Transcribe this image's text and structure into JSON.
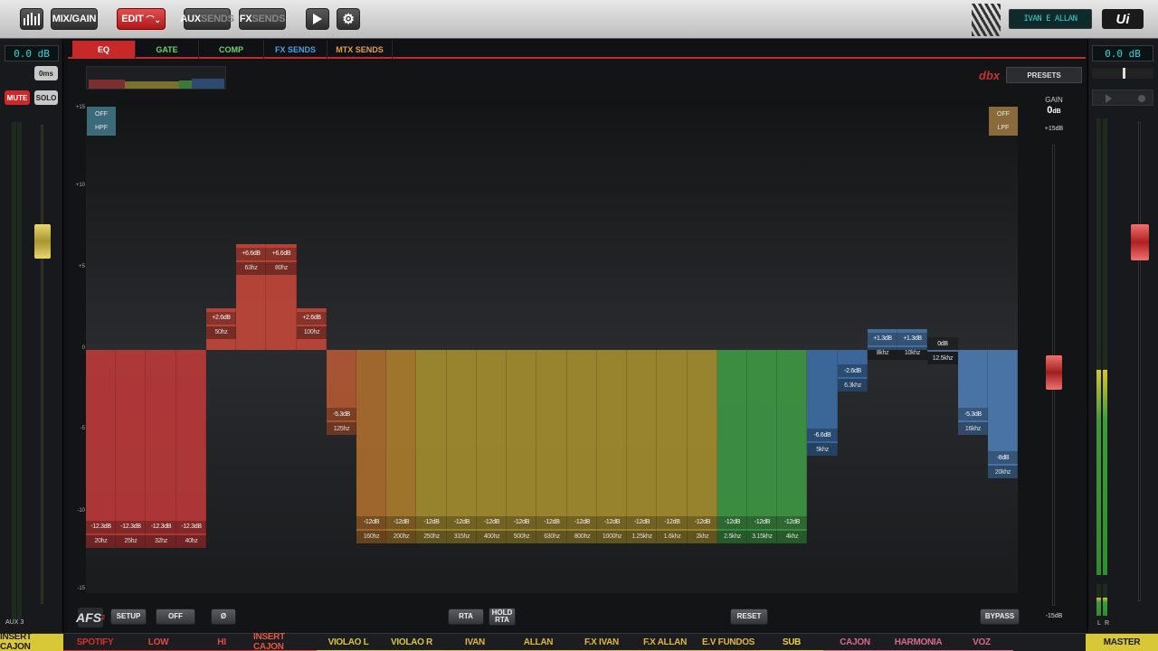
{
  "topbar": {
    "buttons": [
      {
        "id": "meters",
        "label": ""
      },
      {
        "id": "mixgain",
        "label": "MIX/GAIN"
      },
      {
        "id": "edit",
        "label": "EDIT"
      },
      {
        "id": "aux",
        "label_a": "AUX",
        "label_b": "SENDS"
      },
      {
        "id": "fx",
        "label_a": "FX",
        "label_b": "SENDS"
      }
    ],
    "user": "IVAN E ALLAN",
    "logo": "Ui"
  },
  "left_strip": {
    "gain": "0.0 dB",
    "delay": "0ms",
    "mute": "MUTE",
    "solo": "SOLO",
    "channel": "AUX 3"
  },
  "tabs": [
    {
      "label": "EQ",
      "color": "#ffffff"
    },
    {
      "label": "GATE",
      "color": "#6fd06f"
    },
    {
      "label": "COMP",
      "color": "#6fd06f"
    },
    {
      "label": "FX SENDS",
      "color": "#4aa0e0"
    },
    {
      "label": "MTX SENDS",
      "color": "#e0a050"
    }
  ],
  "presets": "PRESETS",
  "dbx": "dbx",
  "gain": {
    "label": "GAIN",
    "value": "0",
    "unit": "dB",
    "top": "+15dB",
    "bottom": "-15dB"
  },
  "eq_axis": [
    "+15",
    "+10",
    "+5",
    "0",
    "-5",
    "-10",
    "-15"
  ],
  "hpf": {
    "state": "OFF",
    "name": "HPF"
  },
  "lpf": {
    "state": "OFF",
    "name": "LPF"
  },
  "bands": [
    {
      "freq": "20hz",
      "gain": -12.3,
      "gain_label": "-12.3dB",
      "color": "#c03a3a"
    },
    {
      "freq": "25hz",
      "gain": -12.3,
      "gain_label": "-12.3dB",
      "color": "#c03a3a"
    },
    {
      "freq": "32hz",
      "gain": -12.3,
      "gain_label": "-12.3dB",
      "color": "#c03a3a"
    },
    {
      "freq": "40hz",
      "gain": -12.3,
      "gain_label": "-12.3dB",
      "color": "#c03a3a"
    },
    {
      "freq": "50hz",
      "gain": 2.6,
      "gain_label": "+2.6dB",
      "color": "#c8483a"
    },
    {
      "freq": "63hz",
      "gain": 6.6,
      "gain_label": "+6.6dB",
      "color": "#c8483a"
    },
    {
      "freq": "80hz",
      "gain": 6.6,
      "gain_label": "+6.6dB",
      "color": "#c8483a"
    },
    {
      "freq": "100hz",
      "gain": 2.6,
      "gain_label": "+2.6dB",
      "color": "#c8483a"
    },
    {
      "freq": "125hz",
      "gain": -5.3,
      "gain_label": "-5.3dB",
      "color": "#b85a34"
    },
    {
      "freq": "160hz",
      "gain": -12,
      "gain_label": "-12dB",
      "color": "#b0702e"
    },
    {
      "freq": "200hz",
      "gain": -12,
      "gain_label": "-12dB",
      "color": "#b0802e"
    },
    {
      "freq": "250hz",
      "gain": -12,
      "gain_label": "-12dB",
      "color": "#a89030"
    },
    {
      "freq": "315hz",
      "gain": -12,
      "gain_label": "-12dB",
      "color": "#a89030"
    },
    {
      "freq": "400hz",
      "gain": -12,
      "gain_label": "-12dB",
      "color": "#a89030"
    },
    {
      "freq": "500hz",
      "gain": -12,
      "gain_label": "-12dB",
      "color": "#a89030"
    },
    {
      "freq": "630hz",
      "gain": -12,
      "gain_label": "-12dB",
      "color": "#a89030"
    },
    {
      "freq": "800hz",
      "gain": -12,
      "gain_label": "-12dB",
      "color": "#a89030"
    },
    {
      "freq": "1000hz",
      "gain": -12,
      "gain_label": "-12dB",
      "color": "#a89030"
    },
    {
      "freq": "1.25khz",
      "gain": -12,
      "gain_label": "-12dB",
      "color": "#a89030"
    },
    {
      "freq": "1.6khz",
      "gain": -12,
      "gain_label": "-12dB",
      "color": "#a89030"
    },
    {
      "freq": "2khz",
      "gain": -12,
      "gain_label": "-12dB",
      "color": "#a89030"
    },
    {
      "freq": "2.5khz",
      "gain": -12,
      "gain_label": "-12dB",
      "color": "#3f9a46"
    },
    {
      "freq": "3.15khz",
      "gain": -12,
      "gain_label": "-12dB",
      "color": "#3f9a46"
    },
    {
      "freq": "4khz",
      "gain": -12,
      "gain_label": "-12dB",
      "color": "#3f9a46"
    },
    {
      "freq": "5khz",
      "gain": -6.6,
      "gain_label": "-6.6dB",
      "color": "#3d6fa8"
    },
    {
      "freq": "6.3khz",
      "gain": -2.6,
      "gain_label": "-2.6dB",
      "color": "#3d6fa8"
    },
    {
      "freq": "8khz",
      "gain": 1.3,
      "gain_label": "+1.3dB",
      "color": "#4a78ad"
    },
    {
      "freq": "10khz",
      "gain": 1.3,
      "gain_label": "+1.3dB",
      "color": "#4a78ad"
    },
    {
      "freq": "12.5khz",
      "gain": 0,
      "gain_label": "0dB",
      "color": "#4a78ad"
    },
    {
      "freq": "16khz",
      "gain": -5.3,
      "gain_label": "-5.3dB",
      "color": "#4d7eb5"
    },
    {
      "freq": "20khz",
      "gain": -8,
      "gain_label": "-8dB",
      "color": "#4d7eb5"
    }
  ],
  "bottom": {
    "afs": "AFS",
    "setup": "SETUP",
    "off": "OFF",
    "phase": "Ø",
    "rta": "RTA",
    "hold_rta": "HOLD RTA",
    "reset": "RESET",
    "bypass": "BYPASS"
  },
  "channels": [
    {
      "label": "INSERT CAJON",
      "color": "#1a1a1a",
      "bg": "#d8c838",
      "line": "#d8c838"
    },
    {
      "label": "SPOTIFY",
      "color": "#d83030",
      "bg": "",
      "line": "#d83030"
    },
    {
      "label": "LOW",
      "color": "#e04848",
      "bg": "",
      "line": "#d83030"
    },
    {
      "label": "HI",
      "color": "#e04848",
      "bg": "",
      "line": "#d83030"
    },
    {
      "label": "INSERT CAJON",
      "color": "#e05848",
      "bg": "",
      "line": "#d85030"
    },
    {
      "label": "VIOLAO L",
      "color": "#d8c838",
      "bg": "",
      "line": "#d8c838"
    },
    {
      "label": "VIOLAO R",
      "color": "#d8c838",
      "bg": "",
      "line": "#d8c838"
    },
    {
      "label": "IVAN",
      "color": "#e0b840",
      "bg": "",
      "line": "#e0b840"
    },
    {
      "label": "ALLAN",
      "color": "#e0b840",
      "bg": "",
      "line": "#e0b840"
    },
    {
      "label": "F.X IVAN",
      "color": "#e0b840",
      "bg": "",
      "line": "#e0b840"
    },
    {
      "label": "F.X ALLAN",
      "color": "#e0b840",
      "bg": "",
      "line": "#e0b840"
    },
    {
      "label": "E.V FUNDOS",
      "color": "#e0b840",
      "bg": "",
      "line": "#e0b840"
    },
    {
      "label": "SUB",
      "color": "#e8d040",
      "bg": "",
      "line": "#e8d040"
    },
    {
      "label": "CAJON",
      "color": "#d86a8a",
      "bg": "",
      "line": "#d86a8a"
    },
    {
      "label": "HARMONIA",
      "color": "#d86a8a",
      "bg": "",
      "line": "#d86a8a"
    },
    {
      "label": "VOZ",
      "color": "#d86a8a",
      "bg": "",
      "line": "#d86a8a"
    },
    {
      "label": "MASTER",
      "color": "#1a1a1a",
      "bg": "#d8c838",
      "line": "#d8c838"
    }
  ],
  "right_strip": {
    "gain": "0.0 dB",
    "meter_l": "L",
    "meter_r": "R",
    "meter_left_level": 0.45,
    "meter_right_level": 0.45
  }
}
